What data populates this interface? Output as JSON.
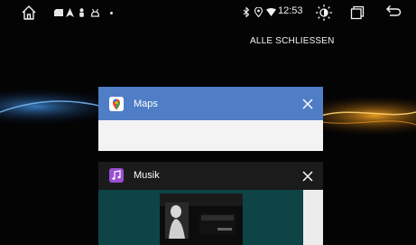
{
  "statusbar": {
    "time": "12:53"
  },
  "recents": {
    "clear_all_label": "ALLE SCHLIESSEN"
  },
  "cards": [
    {
      "title": "Maps",
      "icon": "google-maps-icon"
    },
    {
      "title": "Musik",
      "icon": "music-note-icon"
    }
  ],
  "colors": {
    "maps_header": "#4f7ec6",
    "music_header": "#1b1b1c",
    "music_icon": "#9a4fd1",
    "background": "#040405"
  }
}
